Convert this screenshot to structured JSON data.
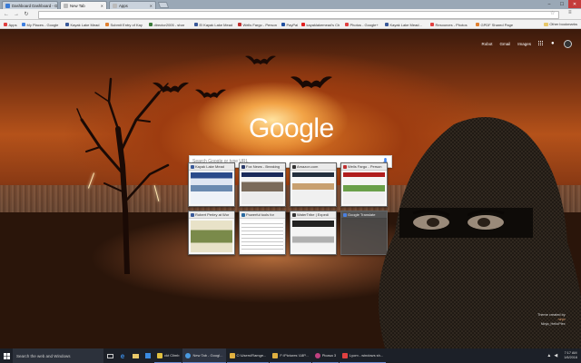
{
  "tabs": [
    {
      "title": "Dashboard Dashboard - G",
      "favicon_color": "#3a7bd5",
      "active": false
    },
    {
      "title": "New Tab",
      "favicon_color": "#aaaaaa",
      "active": true
    },
    {
      "title": "Apps",
      "favicon_color": "#aaaaaa",
      "active": false
    }
  ],
  "address_bar": {
    "value": "",
    "placeholder": ""
  },
  "bookmarks": [
    {
      "label": "Apps",
      "color": "#e04040"
    },
    {
      "label": "My Places - Google",
      "color": "#4080e0"
    },
    {
      "label": "Kayak Lake Mead",
      "color": "#3a5a9a"
    },
    {
      "label": "Submit Entry of Kay",
      "color": "#e08030"
    },
    {
      "label": "director2005 - shar",
      "color": "#3a7a3a"
    },
    {
      "label": "El Kayak Lake Mead",
      "color": "#3a5a9a"
    },
    {
      "label": "Wells Fargo - Person",
      "color": "#c03030"
    },
    {
      "label": "PayPal",
      "color": "#2050a0"
    },
    {
      "label": "kayaklakemead's Ch",
      "color": "#e02020"
    },
    {
      "label": "Photos - Google+",
      "color": "#e04040"
    },
    {
      "label": "Kayak Lake Mead...",
      "color": "#3a5a9a"
    },
    {
      "label": "Resources - Photos",
      "color": "#e04040"
    },
    {
      "label": "GPDF Shared Page",
      "color": "#e08030"
    }
  ],
  "other_bookmarks": "Other bookmarks",
  "user_links": {
    "name": "Robot",
    "gmail": "Gmail",
    "images": "Images"
  },
  "logo_text": "Google",
  "search": {
    "placeholder": "Search Google or type URL"
  },
  "tiles": [
    {
      "title": "Kayak Lake Mead",
      "favicon_color": "#3a5a9a"
    },
    {
      "title": "Fox News - Breaking",
      "favicon_color": "#2a3a6a"
    },
    {
      "title": "Amazon.com",
      "favicon_color": "#333333"
    },
    {
      "title": "Wells Fargo - Person",
      "favicon_color": "#c03030"
    },
    {
      "title": "Robert Perley at Wor",
      "favicon_color": "#3a5a9a"
    },
    {
      "title": "Powerful tools for",
      "favicon_color": "#2a6aa0"
    },
    {
      "title": "WaterTribe | Expedi",
      "favicon_color": "#333333"
    },
    {
      "title": "Google Translate",
      "favicon_color": "#4a80e0"
    }
  ],
  "theme_credit": {
    "line1": "Theme created by",
    "line2": "ninja",
    "line3": "Ninja_HelloPlex"
  },
  "taskbar": {
    "search_placeholder": "Search the web and Windows",
    "tasks": [
      {
        "label": "ckt Climb",
        "color": "#e0c040"
      },
      {
        "label": "New Tab - Googl...",
        "color": "#4a9ae0"
      },
      {
        "label": "C:\\Users\\Ramge...",
        "color": "#e0b040"
      },
      {
        "label": "F:\\Pictures \\18P...",
        "color": "#e0b040"
      },
      {
        "label": "Picasa 3",
        "color": "#c04080"
      },
      {
        "label": "Lyom - windows sh...",
        "color": "#e04040"
      }
    ],
    "time": "7:17 AM",
    "date": "1/6/2016"
  }
}
